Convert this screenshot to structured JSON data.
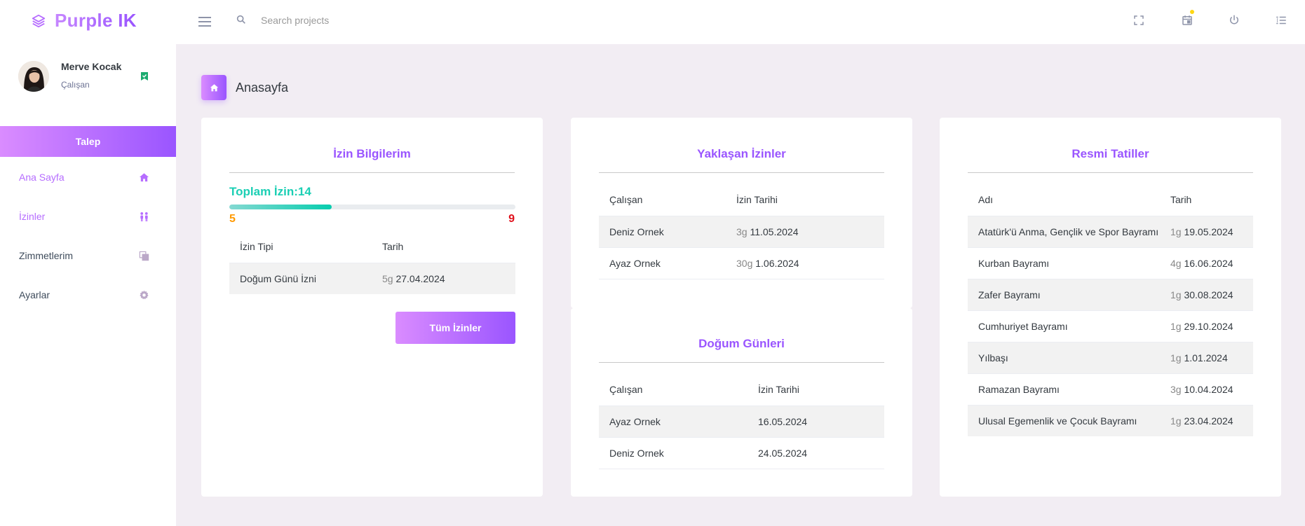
{
  "brand": {
    "name": "Purple IK"
  },
  "search": {
    "placeholder": "Search projects"
  },
  "profile": {
    "name": "Merve Kocak",
    "role": "Çalışan"
  },
  "sidebar": {
    "request_button": "Talep",
    "items": [
      {
        "label": "Ana Sayfa",
        "icon": "home-icon",
        "active": true
      },
      {
        "label": "İzinler",
        "icon": "people-icon",
        "active": false
      },
      {
        "label": "Zimmetlerim",
        "icon": "copy-icon",
        "active": false
      },
      {
        "label": "Ayarlar",
        "icon": "gear-icon",
        "active": false
      }
    ]
  },
  "page": {
    "title": "Anasayfa"
  },
  "leave_info": {
    "title": "İzin Bilgilerim",
    "total_label": "Toplam İzin:14",
    "progress": {
      "used": 5,
      "remaining": 9,
      "fraction": 0.357
    },
    "min_label": "5",
    "max_label": "9",
    "headers": [
      "İzin Tipi",
      "Tarih"
    ],
    "rows": [
      {
        "type": "Doğum Günü İzni",
        "days": "5g",
        "date": "27.04.2024"
      }
    ],
    "button": "Tüm İzinler"
  },
  "upcoming_leaves": {
    "title": "Yaklaşan İzinler",
    "headers": [
      "Çalışan",
      "İzin Tarihi"
    ],
    "rows": [
      {
        "name": "Deniz Ornek",
        "days": "3g",
        "date": "11.05.2024"
      },
      {
        "name": "Ayaz Ornek",
        "days": "30g",
        "date": "1.06.2024"
      }
    ]
  },
  "birthdays": {
    "title": "Doğum Günleri",
    "headers": [
      "Çalışan",
      "İzin Tarihi"
    ],
    "rows": [
      {
        "name": "Ayaz Ornek",
        "date": "16.05.2024"
      },
      {
        "name": "Deniz Ornek",
        "date": "24.05.2024"
      }
    ]
  },
  "holidays": {
    "title": "Resmi Tatiller",
    "headers": [
      "Adı",
      "Tarih"
    ],
    "rows": [
      {
        "name": "Atatürk'ü Anma, Gençlik ve Spor Bayramı",
        "days": "1g",
        "date": "19.05.2024"
      },
      {
        "name": "Kurban Bayramı",
        "days": "4g",
        "date": "16.06.2024"
      },
      {
        "name": "Zafer Bayramı",
        "days": "1g",
        "date": "30.08.2024"
      },
      {
        "name": "Cumhuriyet Bayramı",
        "days": "1g",
        "date": "29.10.2024"
      },
      {
        "name": "Yılbaşı",
        "days": "1g",
        "date": "1.01.2024"
      },
      {
        "name": "Ramazan Bayramı",
        "days": "3g",
        "date": "10.04.2024"
      },
      {
        "name": "Ulusal Egemenlik ve Çocuk Bayramı",
        "days": "1g",
        "date": "23.04.2024"
      }
    ]
  },
  "colors": {
    "accent": "#b66dff",
    "accent_gradient": [
      "#da8cff",
      "#9a55ff"
    ],
    "success": "#1bcfb4",
    "warning": "#ff9900",
    "danger": "#e0101b"
  }
}
